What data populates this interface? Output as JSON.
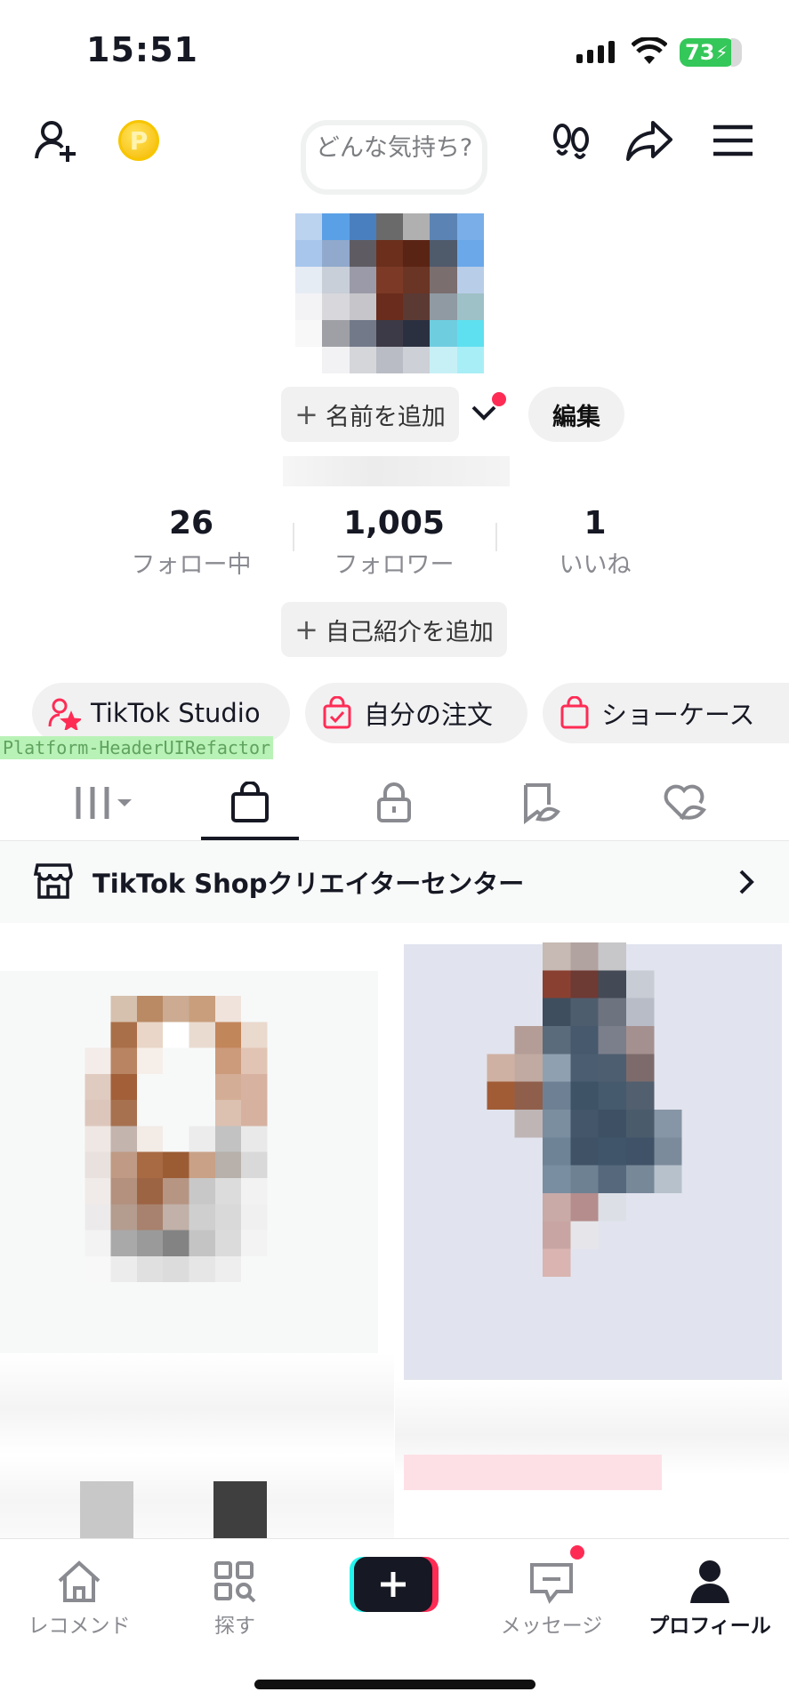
{
  "status_bar": {
    "time": "15:51",
    "battery": "73"
  },
  "header": {
    "mood_bubble": "どんな気持ち?"
  },
  "profile": {
    "add_name_label": "名前を追加",
    "edit_label": "編集",
    "bio_label": "自己紹介を追加",
    "stats": [
      {
        "value": "26",
        "label": "フォロー中"
      },
      {
        "value": "1,005",
        "label": "フォロワー"
      },
      {
        "value": "1",
        "label": "いいね"
      }
    ]
  },
  "shortcuts": [
    {
      "label": "TikTok Studio",
      "icon": "person-star-icon"
    },
    {
      "label": "自分の注文",
      "icon": "bag-check-icon"
    },
    {
      "label": "ショーケース",
      "icon": "bag-icon"
    }
  ],
  "debug_label": "Platform-HeaderUIRefactor",
  "tabs": [
    {
      "icon": "grid-icon",
      "active": false
    },
    {
      "icon": "shop-bag-icon",
      "active": true
    },
    {
      "icon": "lock-icon",
      "active": false
    },
    {
      "icon": "repost-icon",
      "active": false
    },
    {
      "icon": "liked-icon",
      "active": false
    }
  ],
  "shop_banner": {
    "label": "TikTok Shopクリエイターセンター"
  },
  "bottom_nav": {
    "home": "レコメンド",
    "discover": "探す",
    "inbox": "メッセージ",
    "profile": "プロフィール"
  },
  "colors": {
    "accent_red": "#fe2c55",
    "accent_cyan": "#25f4ee",
    "battery_green": "#34c759"
  }
}
